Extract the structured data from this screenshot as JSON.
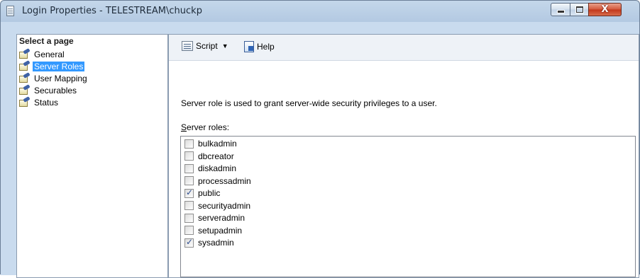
{
  "window": {
    "title": "Login Properties - TELESTREAM\\chuckp",
    "close_glyph": "X"
  },
  "sidebar": {
    "header": "Select a page",
    "items": [
      {
        "label": "General",
        "icon": "page-icon",
        "selected": false
      },
      {
        "label": "Server Roles",
        "icon": "page-icon",
        "selected": true
      },
      {
        "label": "User Mapping",
        "icon": "page-icon",
        "selected": false
      },
      {
        "label": "Securables",
        "icon": "page-icon",
        "selected": false
      },
      {
        "label": "Status",
        "icon": "page-icon",
        "selected": false
      }
    ]
  },
  "toolbar": {
    "script_label": "Script",
    "dropdown_arrow": "▼",
    "help_label": "Help"
  },
  "main": {
    "description": "Server role is used to grant server-wide security privileges to a user.",
    "roles_label_accel": "S",
    "roles_label_rest": "erver roles:",
    "roles": [
      {
        "name": "bulkadmin",
        "checked": false
      },
      {
        "name": "dbcreator",
        "checked": false
      },
      {
        "name": "diskadmin",
        "checked": false
      },
      {
        "name": "processadmin",
        "checked": false
      },
      {
        "name": "public",
        "checked": true
      },
      {
        "name": "securityadmin",
        "checked": false
      },
      {
        "name": "serveradmin",
        "checked": false
      },
      {
        "name": "setupadmin",
        "checked": false
      },
      {
        "name": "sysadmin",
        "checked": true
      }
    ]
  },
  "colors": {
    "selection": "#3399ff",
    "frame": "#c9dbee",
    "close_button": "#c2361a"
  }
}
